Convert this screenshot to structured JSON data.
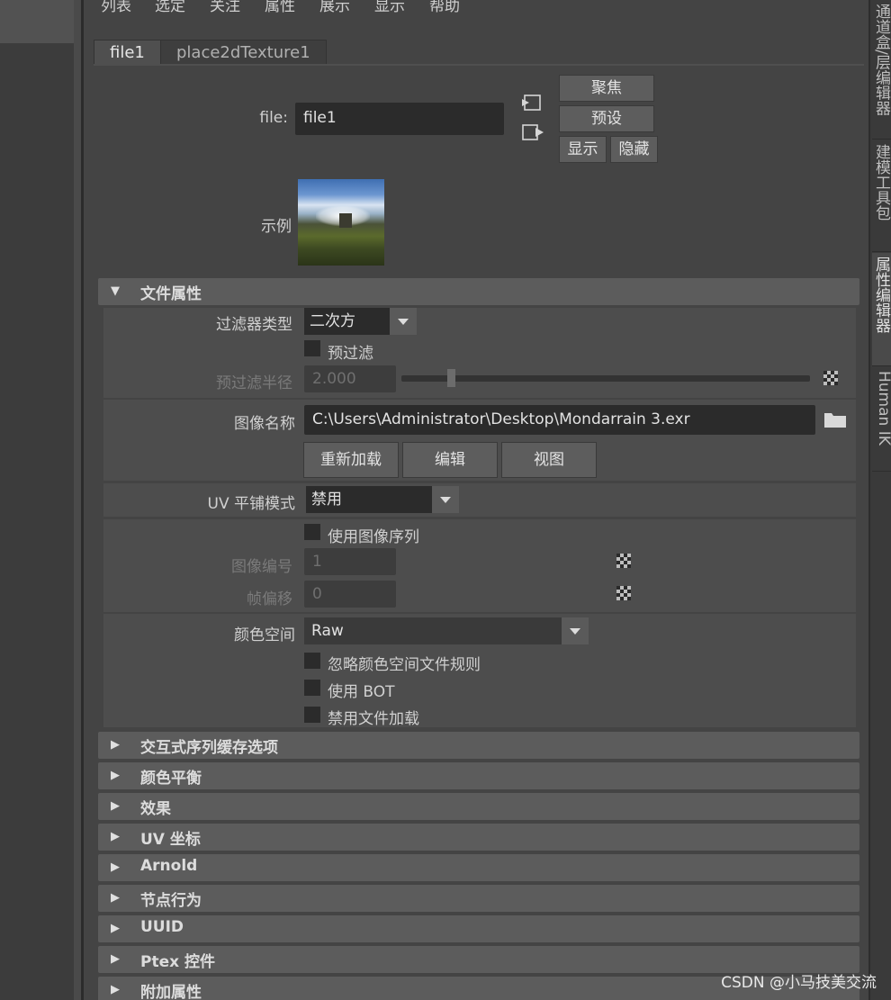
{
  "menu": [
    "列表",
    "选定",
    "关注",
    "属性",
    "展示",
    "显示",
    "帮助"
  ],
  "tabs": [
    "file1",
    "place2dTexture1"
  ],
  "file": {
    "label": "file:",
    "value": "file1"
  },
  "buttons": {
    "focus": "聚焦",
    "presets": "预设",
    "show": "显示",
    "hide": "隐藏"
  },
  "sample_label": "示例",
  "file_attributes": {
    "title": "文件属性",
    "filter_type_label": "过滤器类型",
    "filter_type_value": "二次方",
    "pre_filter_label": "预过滤",
    "pre_filter_radius_label": "预过滤半径",
    "pre_filter_radius_value": "2.000",
    "image_name_label": "图像名称",
    "image_name_value": "C:\\Users\\Administrator\\Desktop\\Mondarrain 3.exr",
    "reload_button": "重新加载",
    "edit_button": "编辑",
    "view_button": "视图",
    "uv_tiling_label": "UV 平铺模式",
    "uv_tiling_value": "禁用",
    "use_image_sequence_label": "使用图像序列",
    "image_number_label": "图像编号",
    "image_number_value": "1",
    "frame_offset_label": "帧偏移",
    "frame_offset_value": "0",
    "color_space_label": "颜色空间",
    "color_space_value": "Raw",
    "ignore_cs_rules_label": "忽略颜色空间文件规则",
    "use_bot_label": "使用 BOT",
    "disable_file_load_label": "禁用文件加载"
  },
  "collapsed_sections": [
    "交互式序列缓存选项",
    "颜色平衡",
    "效果",
    "UV 坐标",
    "Arnold",
    "节点行为",
    "UUID",
    "Ptex 控件",
    "附加属性"
  ],
  "right_dock_tabs": [
    "通道盒/层编辑器",
    "建模工具包",
    "属性编辑器",
    "Human IK"
  ],
  "watermark": "CSDN @小马技美交流",
  "colors": {
    "panel_bg": "#444444",
    "section_header": "#5c5c5c",
    "field_bg": "#2b2b2b"
  }
}
